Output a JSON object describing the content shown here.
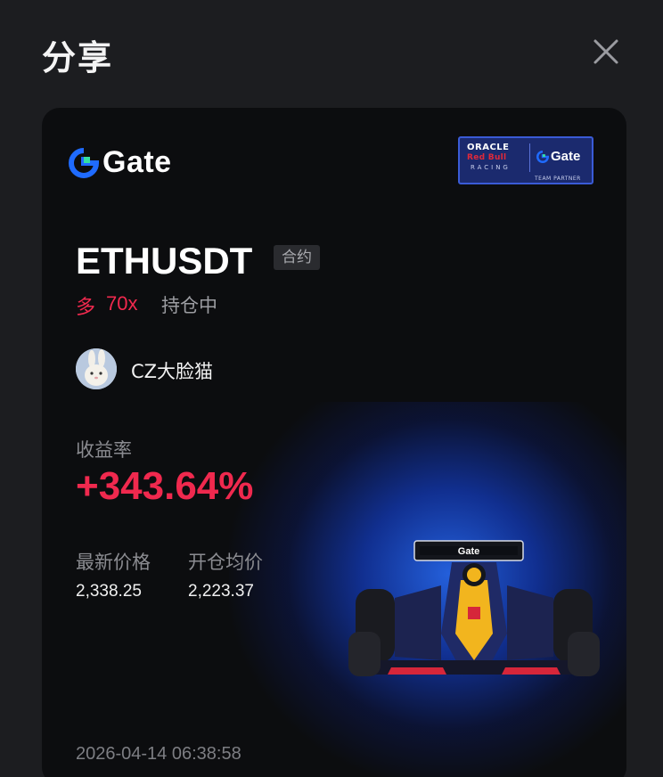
{
  "dialog": {
    "title": "分享",
    "close_icon": "close-icon"
  },
  "card": {
    "brand": {
      "logo_icon": "gate-logo-icon",
      "name": "Gate"
    },
    "partner_badge": {
      "line1": "ORACLE",
      "line2": "Red Bull",
      "line3": "RACING",
      "brand": "Gate",
      "caption": "TEAM PARTNER"
    },
    "position": {
      "symbol": "ETHUSDT",
      "type_tag": "合约",
      "direction": "多",
      "leverage": "70x",
      "status": "持仓中"
    },
    "user": {
      "avatar_icon": "avatar-rabbit-icon",
      "name": "CZ大脸猫"
    },
    "pnl": {
      "label": "收益率",
      "value": "+343.64%"
    },
    "prices": {
      "latest_label": "最新价格",
      "latest_value": "2,338.25",
      "entry_label": "开仓均价",
      "entry_value": "2,223.37"
    },
    "timestamp": "2026-04-14 06:38:58"
  },
  "colors": {
    "background": "#1c1d20",
    "card_bg": "#0c0d0f",
    "accent_red": "#f0294e",
    "gate_blue": "#1f6bff",
    "muted_text": "#8b8c91"
  }
}
